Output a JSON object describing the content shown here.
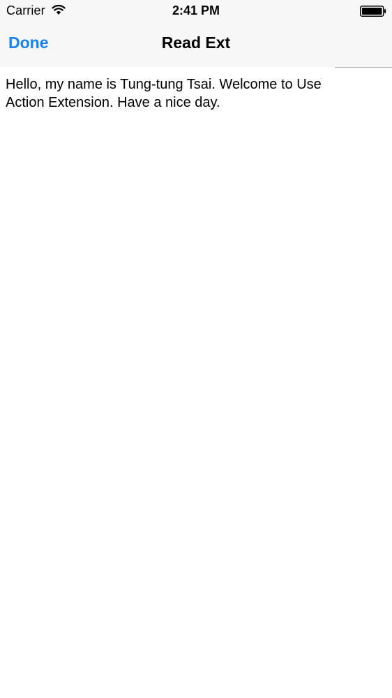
{
  "status_bar": {
    "carrier": "Carrier",
    "time": "2:41 PM",
    "wifi_icon": "wifi-icon",
    "battery_icon": "battery-icon"
  },
  "nav_bar": {
    "done_label": "Done",
    "title": "Read Ext"
  },
  "content": {
    "text": "Hello, my name is Tung-tung Tsai. Welcome to Use Action Extension. Have a nice day."
  },
  "colors": {
    "accent": "#1a82f0",
    "bar_background": "#f7f7f7"
  }
}
